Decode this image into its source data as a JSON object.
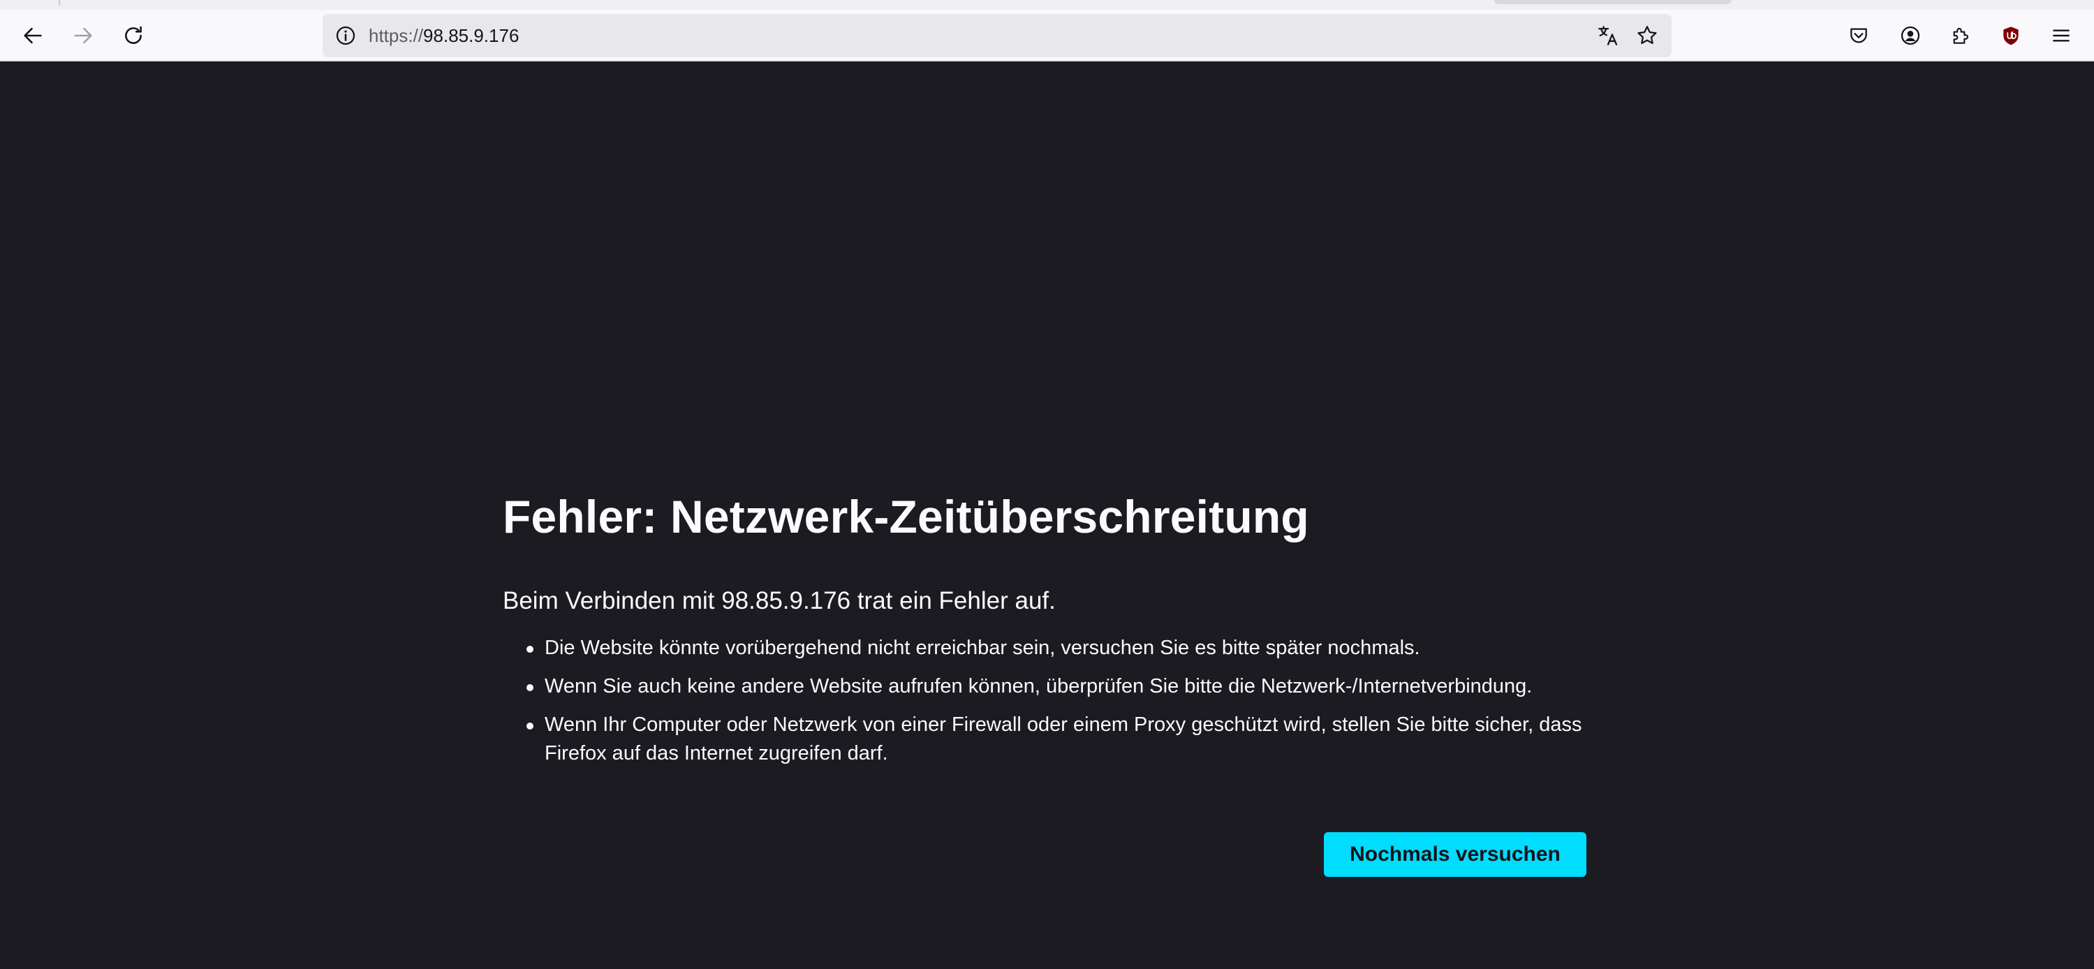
{
  "browser": {
    "url": {
      "scheme": "https://",
      "host": "98.85.9.176"
    },
    "toolbar_icons": [
      "back-arrow-icon",
      "forward-arrow-icon",
      "reload-icon",
      "site-info-icon",
      "translate-icon",
      "bookmark-star-icon",
      "pocket-icon",
      "account-icon",
      "extensions-icon",
      "ublock-origin-icon",
      "menu-icon"
    ],
    "colors": {
      "toolbar_bg": "#f9f9fb",
      "urlbar_bg": "#e8e8ec",
      "ublock_red": "#800000"
    }
  },
  "error_page": {
    "title": "Fehler: Netzwerk-Zeitüberschreitung",
    "intro": "Beim Verbinden mit 98.85.9.176 trat ein Fehler auf.",
    "bullets": [
      "Die Website könnte vorübergehend nicht erreichbar sein, versuchen Sie es bitte später nochmals.",
      "Wenn Sie auch keine andere Website aufrufen können, überprüfen Sie bitte die Netzwerk-/Internetverbindung.",
      "Wenn Ihr Computer oder Netzwerk von einer Firewall oder einem Proxy geschützt wird, stellen Sie bitte sicher, dass Firefox auf das Internet zugreifen darf."
    ],
    "retry_button": "Nochmals versuchen",
    "colors": {
      "background": "#1c1b22",
      "text": "#fbfbfe",
      "button": "#00ddff"
    }
  }
}
